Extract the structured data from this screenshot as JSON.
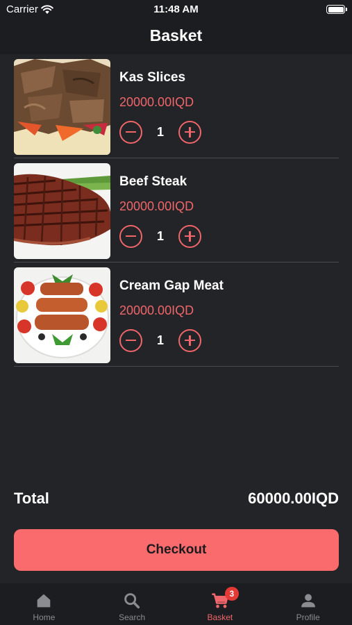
{
  "status_bar": {
    "carrier": "Carrier",
    "time": "11:48 AM"
  },
  "header": {
    "title": "Basket"
  },
  "items": [
    {
      "name": "Kas Slices",
      "price": "20000.00IQD",
      "quantity": "1",
      "image_icon": "shawarma-photo"
    },
    {
      "name": "Beef Steak",
      "price": "20000.00IQD",
      "quantity": "1",
      "image_icon": "steak-photo"
    },
    {
      "name": "Cream Gap Meat",
      "price": "20000.00IQD",
      "quantity": "1",
      "image_icon": "kebab-plate-photo"
    }
  ],
  "summary": {
    "total_label": "Total",
    "total_amount": "60000.00IQD"
  },
  "checkout": {
    "label": "Checkout"
  },
  "tabs": [
    {
      "label": "Home",
      "icon": "home-icon",
      "active": false
    },
    {
      "label": "Search",
      "icon": "search-icon",
      "active": false
    },
    {
      "label": "Basket",
      "icon": "cart-icon",
      "active": true,
      "badge": "3"
    },
    {
      "label": "Profile",
      "icon": "person-icon",
      "active": false
    }
  ],
  "colors": {
    "accent": "#f0666a",
    "button": "#f96b6d",
    "background": "#232428",
    "bar": "#1c1d21",
    "badge": "#e53935"
  }
}
